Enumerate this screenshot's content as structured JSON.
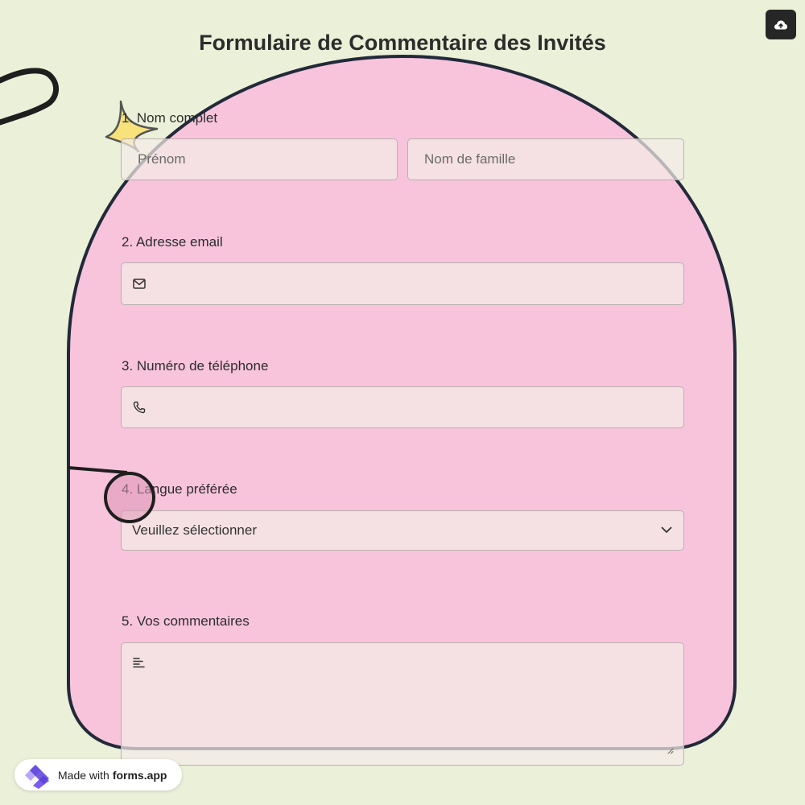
{
  "form": {
    "title": "Formulaire de Commentaire des Invités",
    "questions": [
      {
        "label": "1. Nom complet",
        "first_placeholder": "Prénom",
        "last_placeholder": "Nom de famille"
      },
      {
        "label": "2. Adresse email",
        "icon": "mail-icon",
        "value": ""
      },
      {
        "label": "3. Numéro de téléphone",
        "icon": "phone-icon",
        "value": ""
      },
      {
        "label": "4. Langue préférée",
        "selected": "Veuillez sélectionner",
        "icon": "chevron-down-icon"
      },
      {
        "label": "5. Vos commentaires",
        "icon": "text-align-icon",
        "value": ""
      }
    ]
  },
  "toolbar": {
    "upload_icon": "cloud-upload-icon"
  },
  "badge": {
    "prefix": "Made with",
    "brand": "forms.app"
  },
  "colors": {
    "background": "#ebf0d9",
    "arch_fill": "#f7c4dc",
    "arch_stroke": "#222a3a",
    "star": "#f7e27c",
    "button_dark": "#262626",
    "logo_purple": "#7b5cf0"
  }
}
